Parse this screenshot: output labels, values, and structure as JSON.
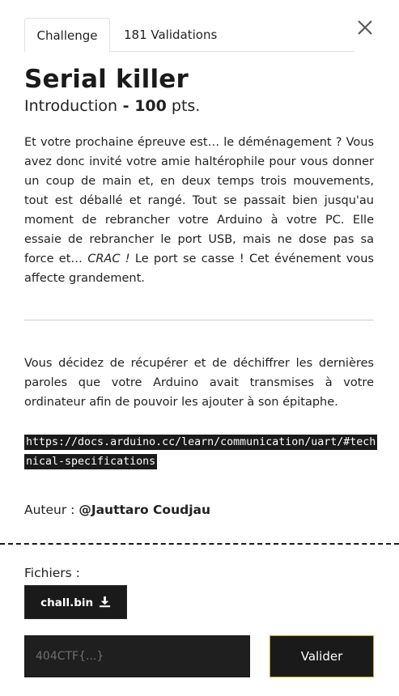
{
  "tabs": [
    {
      "label": "Challenge"
    },
    {
      "label": "181 Validations"
    }
  ],
  "challenge": {
    "title": "Serial killer",
    "category": "Introduction",
    "separator": " - ",
    "points": "100",
    "points_suffix": " pts.",
    "description_1a": "Et votre prochaine épreuve est… le déménagement ? Vous avez donc invité votre amie haltérophile pour vous donner un coup de main et, en deux temps trois mouvements, tout est déballé et rangé. Tout se passait bien jusqu'au moment de rebrancher votre Arduino à votre PC. Elle essaie de rebrancher le port USB, mais ne dose pas sa force et… ",
    "description_1_italic": "CRAC !",
    "description_1b": " Le port se casse ! Cet événement vous affecte grandement.",
    "description_2": "Vous décidez de récupérer et de déchiffrer les dernières paroles que votre Arduino avait transmises à votre ordinateur afin de pouvoir les ajouter à son épitaphe.",
    "link": "https://docs.arduino.cc/learn/communication/uart/#technical-specifications",
    "author_label": "Auteur : ",
    "author_name": "@Jauttaro Coudjau"
  },
  "files": {
    "label": "Fichiers :",
    "items": [
      {
        "name": "chall.bin",
        "icon": "download-icon"
      }
    ]
  },
  "submission": {
    "placeholder": "404CTF{...}",
    "value": "",
    "button_label": "Valider"
  },
  "colors": {
    "dark": "#1a1a1a",
    "accent_border": "#c9a227"
  }
}
